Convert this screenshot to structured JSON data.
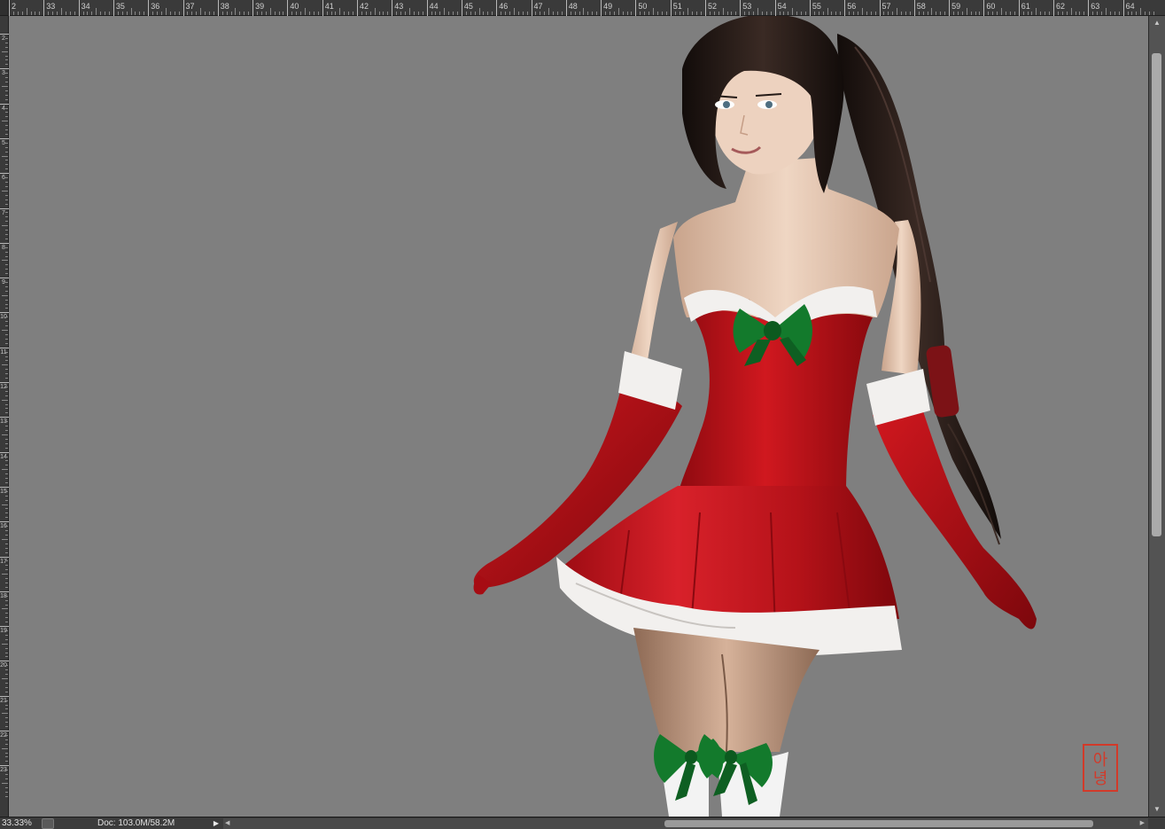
{
  "rulers": {
    "top_labels": [
      "2",
      "33",
      "34",
      "35",
      "36",
      "37",
      "38",
      "39",
      "40",
      "41",
      "42",
      "43",
      "44",
      "45",
      "46",
      "47",
      "48",
      "49",
      "50",
      "51",
      "52",
      "53",
      "54",
      "55",
      "56",
      "57",
      "58",
      "59",
      "60",
      "61",
      "62",
      "63",
      "64"
    ],
    "left_labels": [
      "2",
      "3",
      "4",
      "5",
      "6",
      "7",
      "8",
      "9",
      "10",
      "11",
      "12",
      "13",
      "14",
      "15",
      "16",
      "17",
      "18",
      "19",
      "20",
      "21",
      "22",
      "23"
    ]
  },
  "artwork": {
    "description_icon": "santa-costume-illustration",
    "signature_stamp_text": "아녕",
    "colors": {
      "canvas_bg": "#7f7f7f",
      "dress_red": "#c8141c",
      "fur_white": "#f2f0ee",
      "bow_green": "#137a2c",
      "hair": "#1e1512",
      "skin": "#e8c9b2",
      "stamp_red": "#d23a2a"
    }
  },
  "statusbar": {
    "zoom": "33.33%",
    "doc_info": "Doc: 103.0M/58.2M"
  }
}
